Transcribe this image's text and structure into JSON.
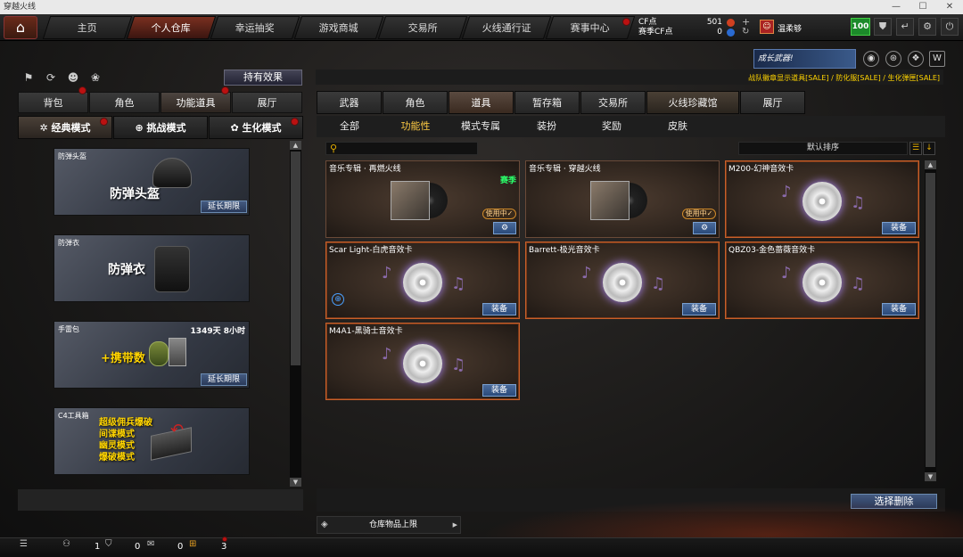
{
  "window": {
    "title": "穿越火线"
  },
  "topnav": {
    "tabs": [
      "主页",
      "个人仓库",
      "幸运抽奖",
      "游戏商城",
      "交易所",
      "火线通行证",
      "赛事中心"
    ],
    "active": "个人仓库",
    "cf_label": "CF点",
    "season_cf_label": "赛季CF点",
    "cf_value": "501",
    "season_cf_value": "0",
    "username": "温柔够",
    "level": "100"
  },
  "left": {
    "hold_effect": "持有效果",
    "tabs": [
      "背包",
      "角色",
      "功能道具",
      "展厅"
    ],
    "active_tab": "功能道具",
    "modes": [
      "经典模式",
      "挑战模式",
      "生化模式"
    ],
    "items": [
      {
        "name": "防弹头盔",
        "art_text": "防弹头盔",
        "button": "延长期限",
        "time": ""
      },
      {
        "name": "防弹衣",
        "art_text": "防弹衣",
        "button": "",
        "time": ""
      },
      {
        "name": "手雷包",
        "art_text": "+携带数",
        "button": "延长期限",
        "time": "1349天 8小时"
      },
      {
        "name": "C4工具箱",
        "art_text": "超级佣兵爆破\n间谍模式\n幽灵模式\n爆破模式",
        "button": "",
        "time": ""
      }
    ]
  },
  "right": {
    "banner": "成长武器!",
    "promo": "战队徽章显示道具[SALE] / 防化服[SALE] / 生化弹匣[SALE]",
    "tabs": [
      "武器",
      "角色",
      "道具",
      "暂存箱",
      "交易所",
      "火线珍藏馆",
      "展厅"
    ],
    "active_tab": "道具",
    "subtabs": [
      "全部",
      "功能性",
      "模式专属",
      "装扮",
      "奖励",
      "皮肤"
    ],
    "active_subtab": "功能性",
    "search_placeholder": "",
    "sort_label": "默认排序",
    "cards": [
      {
        "name": "音乐专辑 · 再燃火线",
        "type": "album",
        "status": "使用中✓",
        "badge": "赛季",
        "button": "⚙"
      },
      {
        "name": "音乐专辑 · 穿越火线",
        "type": "album",
        "status": "使用中✓",
        "badge": "",
        "button": "⚙"
      },
      {
        "name": "M200-幻神音效卡",
        "type": "card",
        "status": "",
        "badge": "",
        "button": "装备"
      },
      {
        "name": "Scar Light-白虎音效卡",
        "type": "card",
        "status": "",
        "badge": "",
        "button": "装备"
      },
      {
        "name": "Barrett-极光音效卡",
        "type": "card",
        "status": "",
        "badge": "",
        "button": "装备"
      },
      {
        "name": "QBZ03-金色蔷薇音效卡",
        "type": "card",
        "status": "",
        "badge": "",
        "button": "装备"
      },
      {
        "name": "M4A1-黑骑士音效卡",
        "type": "card",
        "status": "",
        "badge": "",
        "button": "装备"
      }
    ],
    "delete_button": "选择删除",
    "capacity_label": "仓库物品上限"
  },
  "status": {
    "friends": "1",
    "shield": "0",
    "chat": "0",
    "gift": "3"
  }
}
